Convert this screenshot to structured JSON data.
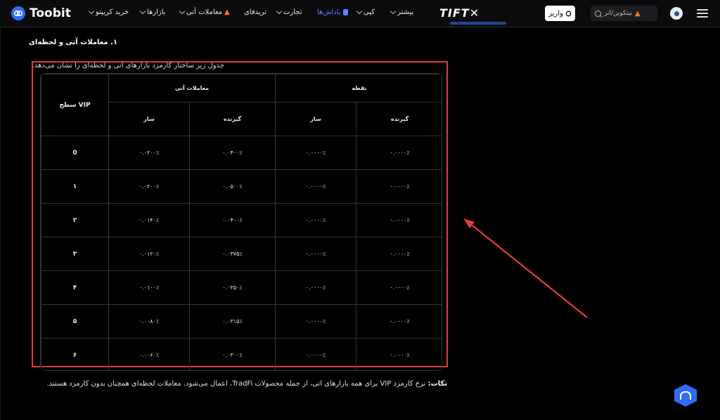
{
  "nav": {
    "logo_text": "Toobit",
    "items": [
      {
        "label": "خرید کریپتو",
        "chevron": false
      },
      {
        "label": "بازارها",
        "chevron": true
      },
      {
        "label": "معاملات آتی",
        "chevron": true
      },
      {
        "label": "تریدفای",
        "chevron": false
      },
      {
        "label": "تجارت",
        "chevron": true
      },
      {
        "label": "پاداش‌ها",
        "chevron": false
      },
      {
        "label": "کپی",
        "chevron": true
      },
      {
        "label": "بیشتر",
        "chevron": true
      }
    ],
    "brand_center": "TIFT✕",
    "deposit_label": "واریز",
    "search_placeholder": "بیتکوین/اتر",
    "icons": {
      "search": "search-icon",
      "avatar": "user-avatar-icon",
      "menu": "hamburger-icon"
    }
  },
  "section": {
    "title": "۱. معاملات آتی و لحظه‌ای",
    "description": "جدول زیر ساختار کارمزد بازارهای آتی و لحظه‌ای را نشان می‌دهد."
  },
  "table": {
    "vip_header": "سطح VIP",
    "group_futures": "معاملات آتی",
    "group_spot": "نقطه",
    "maker": "ساز",
    "taker": "گیرنده",
    "rows": [
      {
        "vip": "0",
        "fut_maker": "۰.۰۲۰۰٪",
        "fut_taker": "۰.۰۴۰۰٪",
        "spot_maker": "۰.۰۰۰۰٪",
        "spot_taker": "۰.۰۰۰۰٪"
      },
      {
        "vip": "۱",
        "fut_maker": "۰.۰۲۰۰٪",
        "fut_taker": "۰.۰۵۰۰٪",
        "spot_maker": "۰.۰۰۰۰٪",
        "spot_taker": "۰.۰۰۰۰٪"
      },
      {
        "vip": "۲",
        "fut_maker": "۰.۰۱۴۰٪",
        "fut_taker": "۰.۰۴۰۰٪",
        "spot_maker": "۰.۰۰۰۰٪",
        "spot_taker": "۰.۰۰۰۰٪"
      },
      {
        "vip": "۳",
        "fut_maker": "۰.۰۱۲۰٪",
        "fut_taker": "۰.۰۳۷۵٪",
        "spot_maker": "۰.۰۰۰۰٪",
        "spot_taker": "۰.۰۰۰۰٪"
      },
      {
        "vip": "۴",
        "fut_maker": "۰.۰۱۰۰٪",
        "fut_taker": "۰.۰۳۵۰٪",
        "spot_maker": "۰.۰۰۰۰٪",
        "spot_taker": "۰.۰۰۰۰٪"
      },
      {
        "vip": "۵",
        "fut_maker": "۰.۰۰۸۰٪",
        "fut_taker": "۰.۰۳۱۵٪",
        "spot_maker": "۰.۰۰۰۰٪",
        "spot_taker": "۰.۰۰۰۰٪"
      },
      {
        "vip": "۶",
        "fut_maker": "۰.۰۰۶۰٪",
        "fut_taker": "۰.۰۳۰۰٪",
        "spot_maker": "۰.۰۰۰۰٪",
        "spot_taker": "۰.۰۰۰۰٪"
      }
    ]
  },
  "note": {
    "label": "نکات:",
    "text": "نرخ کارمزد VIP برای همه بازارهای آتی، از جمله محصولات TradFi، اعمال می‌شود. معاملات لحظه‌ای همچنان بدون کارمزد هستند."
  },
  "colors": {
    "accent": "#2f6df6",
    "highlight": "#e33b3b",
    "background": "#000000"
  }
}
